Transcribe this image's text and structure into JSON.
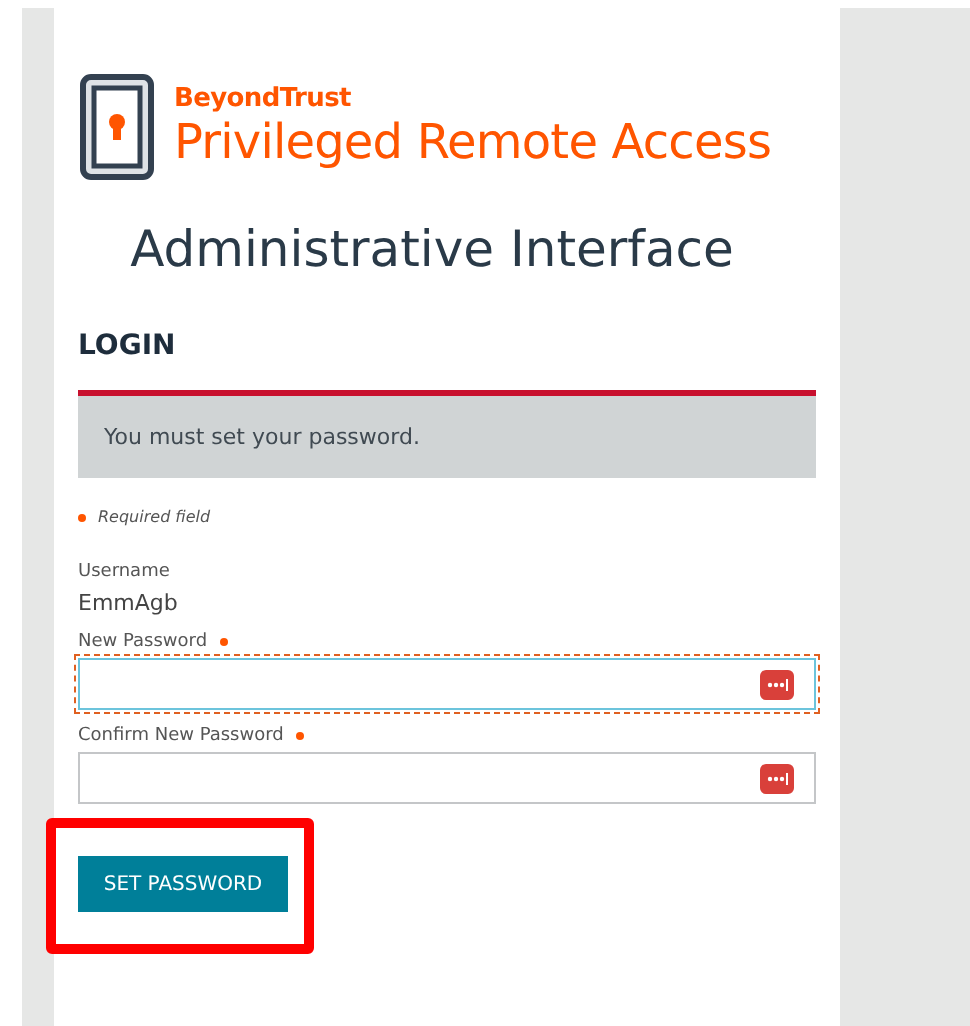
{
  "logo": {
    "company": "BeyondTrust",
    "product": "Privileged Remote Access"
  },
  "title": "Administrative Interface",
  "section_heading": "LOGIN",
  "alert": {
    "message": "You must set your password."
  },
  "required_note": "Required field",
  "username": {
    "label": "Username",
    "value": "EmmAgb"
  },
  "fields": [
    {
      "label": "New Password",
      "required": true,
      "focused": true
    },
    {
      "label": "Confirm New Password",
      "required": true,
      "focused": false
    }
  ],
  "submit_button": {
    "label": "SET PASSWORD",
    "highlighted": true
  }
}
